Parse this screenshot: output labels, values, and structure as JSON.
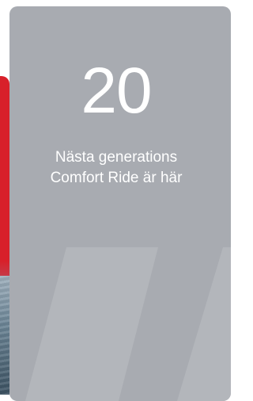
{
  "card": {
    "number": "20",
    "tagline_line1": "Nästa generations",
    "tagline_line2": "Comfort Ride är här",
    "background_color": "#a8abb1",
    "text_color": "#ffffff"
  },
  "left_card": {
    "accent_color": "#d8202a"
  }
}
